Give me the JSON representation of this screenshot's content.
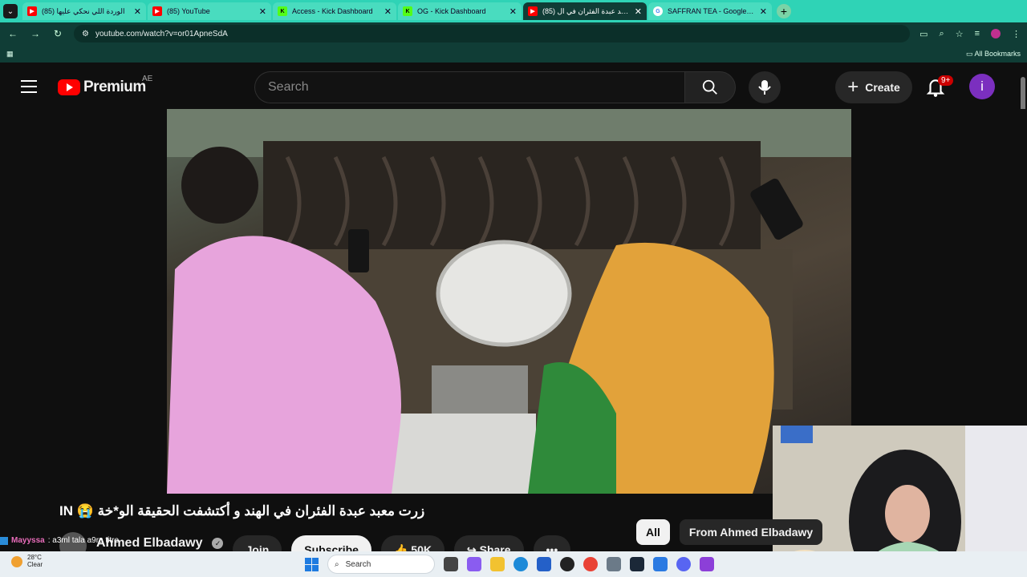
{
  "browser": {
    "tabs": [
      {
        "title": "(85) الوردة اللي نحكي عليها",
        "favicon": "youtube-icon",
        "active": false
      },
      {
        "title": "(85) YouTube",
        "favicon": "youtube-icon",
        "active": false
      },
      {
        "title": "Access - Kick Dashboard",
        "favicon": "kick-icon",
        "active": false
      },
      {
        "title": "OG - Kick Dashboard",
        "favicon": "kick-icon",
        "active": false
      },
      {
        "title": "(85) زرت معبد عبدة الفئران في ال",
        "favicon": "youtube-icon",
        "active": true
      },
      {
        "title": "SAFFRAN TEA - Google Search",
        "favicon": "google-icon",
        "active": false
      }
    ],
    "url": "youtube.com/watch?v=or01ApneSdA",
    "bookmarks_label": "All Bookmarks"
  },
  "youtube": {
    "logo_text": "Premium",
    "region": "AE",
    "search_placeholder": "Search",
    "create_label": "Create",
    "notification_count": "9+",
    "avatar_letter": "i"
  },
  "video": {
    "title": "زرت معبد عبدة الفئران في الهند و أكتشفت الحقيقة الو*خة 😭 IN",
    "channel": "Ahmed Elbadawy",
    "join_label": "Join",
    "subscribe_label": "Subscribe",
    "likes": "50K",
    "share_label": "Share",
    "more_label": "•••"
  },
  "chips": [
    "All",
    "From Ahmed Elbadawy"
  ],
  "stream_chat": {
    "user": "Mayyssa",
    "message": ": a3ml tala a9ra titre"
  },
  "taskbar": {
    "temperature": "28°C",
    "condition": "Clear",
    "search_label": "Search"
  },
  "colors": {
    "tabbar": "#2fd3b6",
    "toolbar": "#103d36",
    "youtube_red": "#ff0000",
    "avatar": "#7b2fbf"
  }
}
